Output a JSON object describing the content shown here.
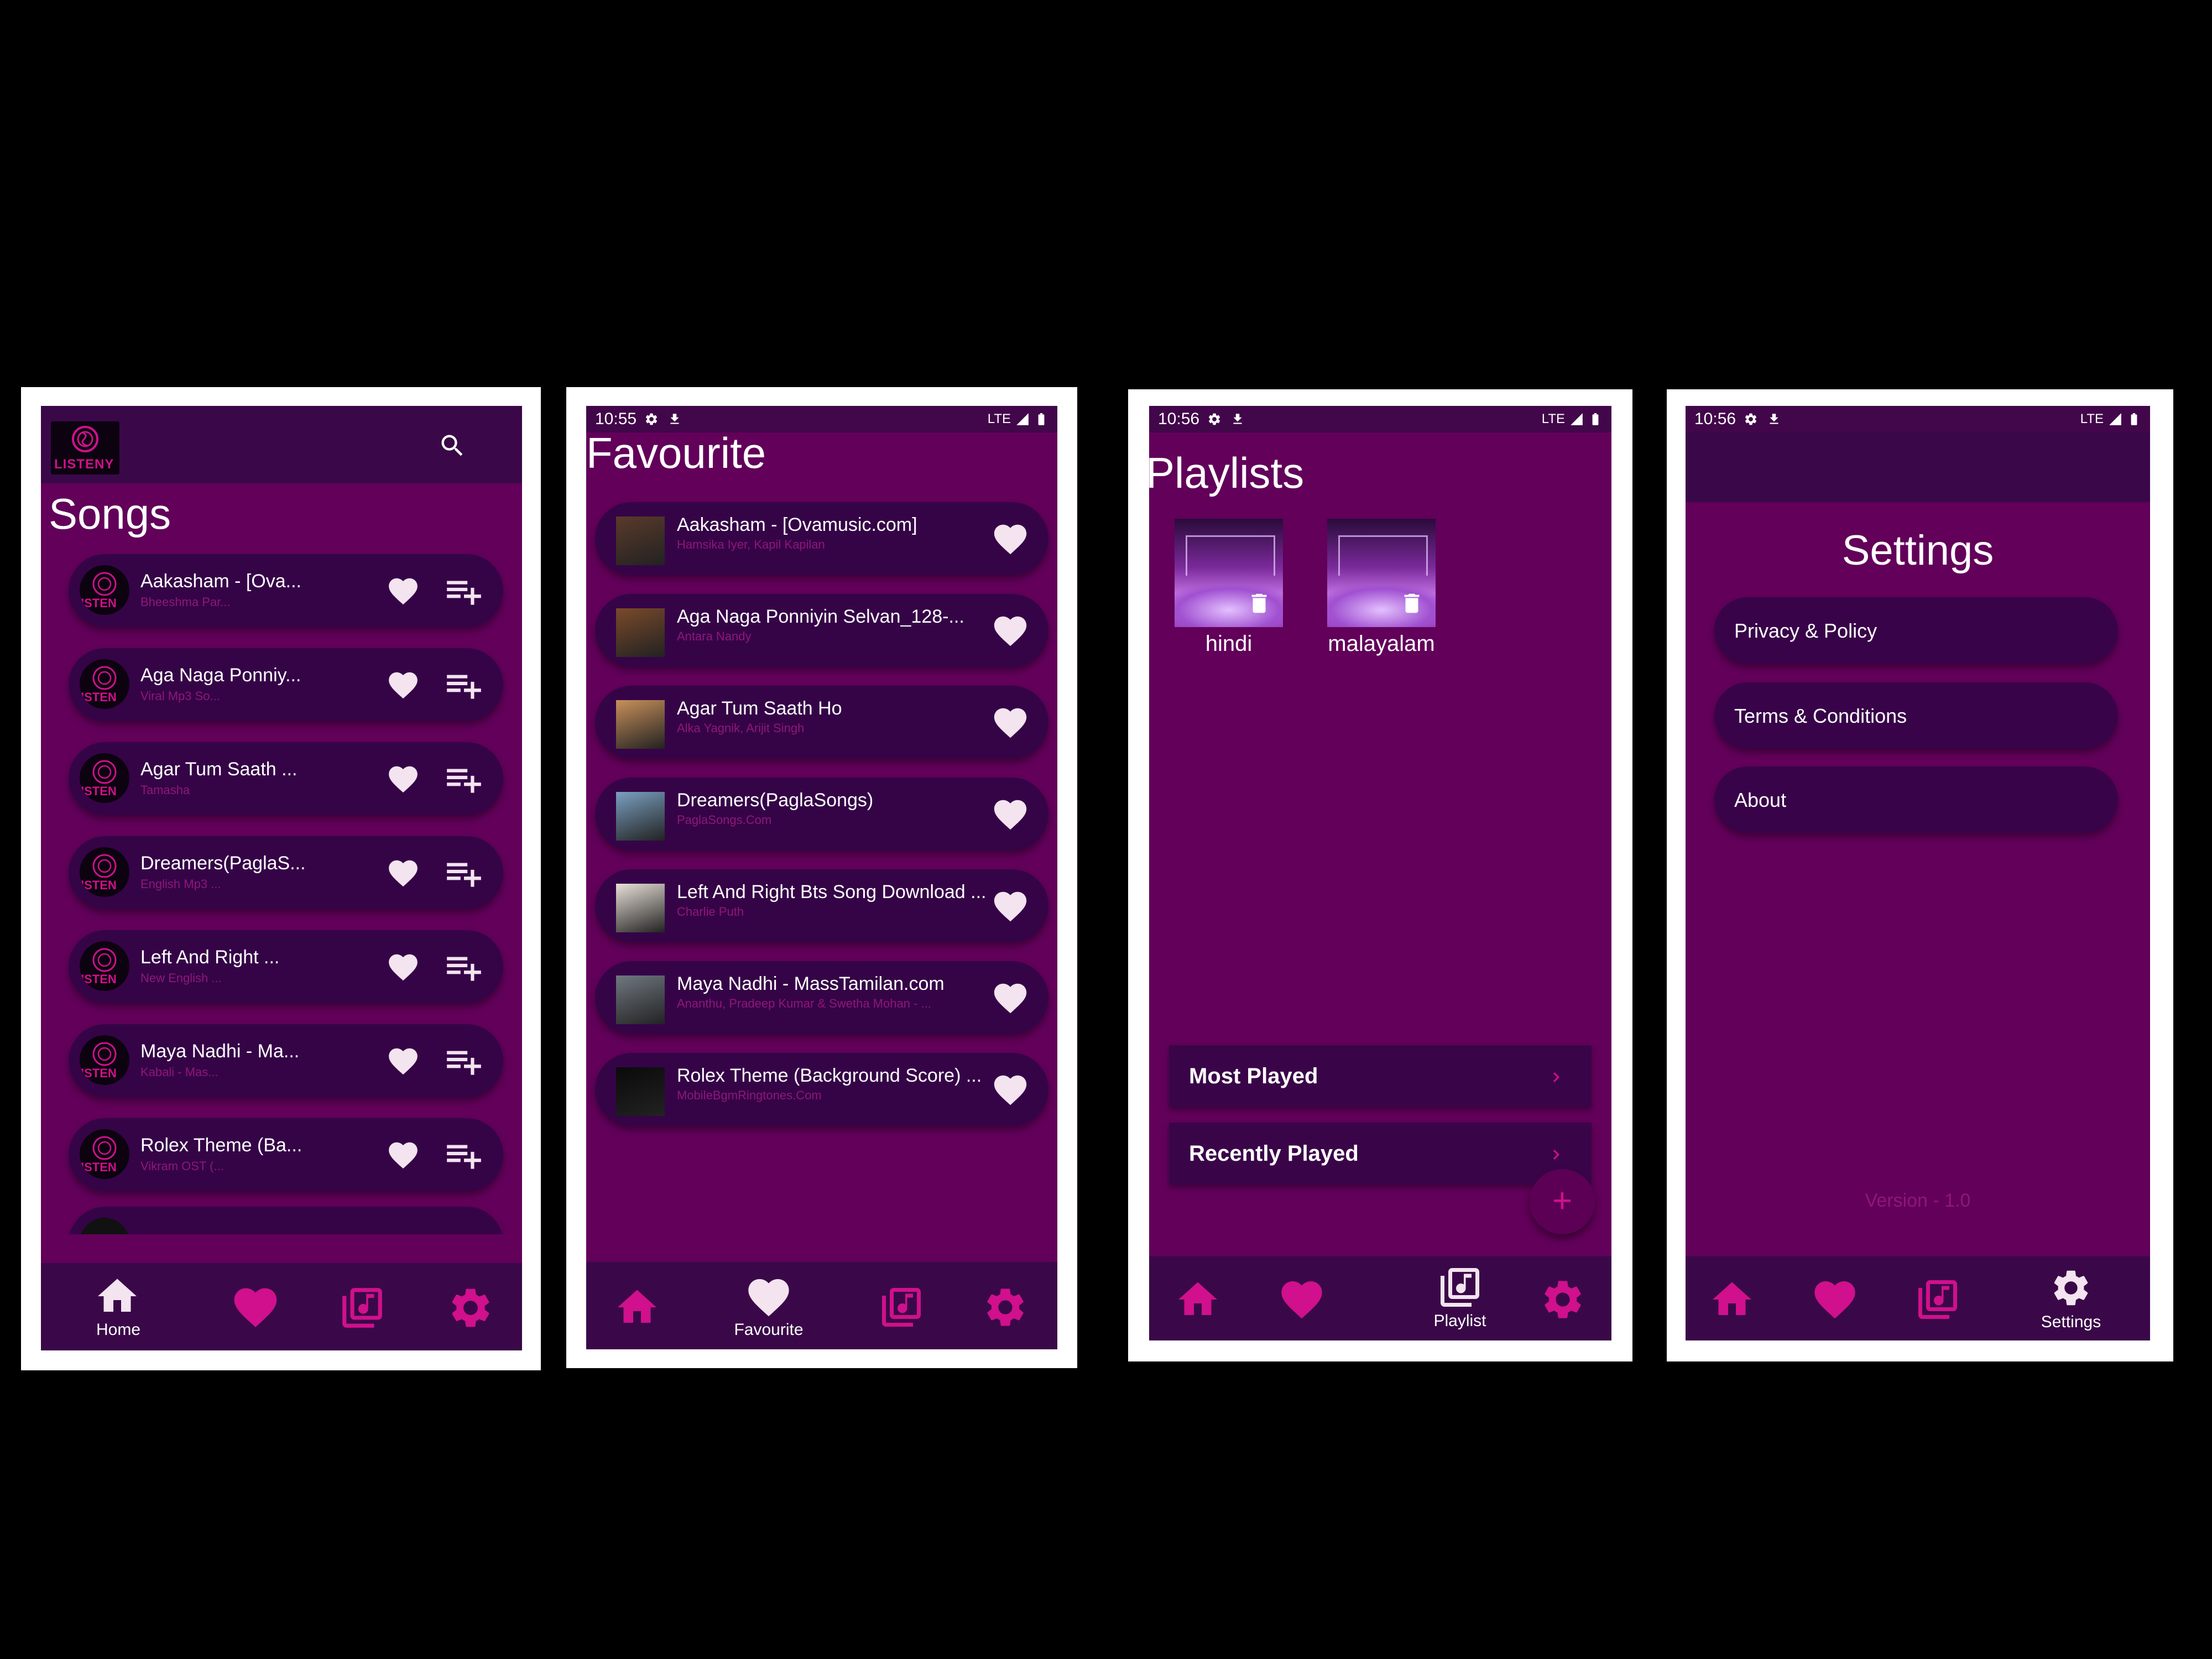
{
  "colors": {
    "accent": "#d0108c",
    "background": "#62005a",
    "bar": "#3a0848",
    "item": "#350447",
    "heart_white": "#f3e4f0"
  },
  "screen1": {
    "logo_text": "LISTENY",
    "title": "Songs",
    "songs": [
      {
        "title": "Aakasham - [Ova...",
        "artist": "Bheeshma Par..."
      },
      {
        "title": "Aga Naga Ponniy...",
        "artist": "Viral Mp3 So..."
      },
      {
        "title": "Agar Tum Saath ...",
        "artist": "Tamasha"
      },
      {
        "title": "Dreamers(PaglaS...",
        "artist": "English Mp3 ..."
      },
      {
        "title": "Left And Right ...",
        "artist": "New English ..."
      },
      {
        "title": "Maya Nadhi - Ma...",
        "artist": "Kabali - Mas..."
      },
      {
        "title": "Rolex Theme (Ba...",
        "artist": "Vikram OST (..."
      }
    ],
    "thumb_text": "ISTEN",
    "nav": {
      "home_label": "Home"
    },
    "icons": [
      "search-icon",
      "heart-icon",
      "playlist-add-icon",
      "home-icon",
      "library-music-icon",
      "settings-icon"
    ]
  },
  "screen2": {
    "time": "10:55",
    "network": "LTE",
    "title": "Favourite",
    "songs": [
      {
        "title": "Aakasham - [Ovamusic.com]",
        "artist": "Hamsika Iyer, Kapil Kapilan"
      },
      {
        "title": "Aga Naga Ponniyin Selvan_128-...",
        "artist": "Antara Nandy"
      },
      {
        "title": "Agar Tum Saath Ho",
        "artist": "Alka Yagnik, Arijit Singh"
      },
      {
        "title": "Dreamers(PaglaSongs)",
        "artist": "PaglaSongs.Com"
      },
      {
        "title": "Left And Right Bts Song Download ...",
        "artist": "Charlie Puth"
      },
      {
        "title": "Maya Nadhi - MassTamilan.com",
        "artist": "Ananthu, Pradeep Kumar & Swetha Mohan - ..."
      },
      {
        "title": "Rolex Theme (Background Score) ...",
        "artist": "MobileBgmRingtones.Com"
      }
    ],
    "nav": {
      "favourite_label": "Favourite"
    }
  },
  "screen3": {
    "time": "10:56",
    "network": "LTE",
    "title": "Playlists",
    "playlists": [
      {
        "name": "hindi"
      },
      {
        "name": "malayalam"
      }
    ],
    "rows": [
      {
        "label": "Most Played"
      },
      {
        "label": "Recently Played"
      }
    ],
    "fab": "+",
    "nav": {
      "playlist_label": "Playlist"
    }
  },
  "screen4": {
    "time": "10:56",
    "network": "LTE",
    "title": "Settings",
    "items": [
      {
        "label": "Privacy & Policy"
      },
      {
        "label": "Terms & Conditions"
      },
      {
        "label": "About"
      }
    ],
    "version": "Version - 1.0",
    "nav": {
      "settings_label": "Settings"
    }
  }
}
